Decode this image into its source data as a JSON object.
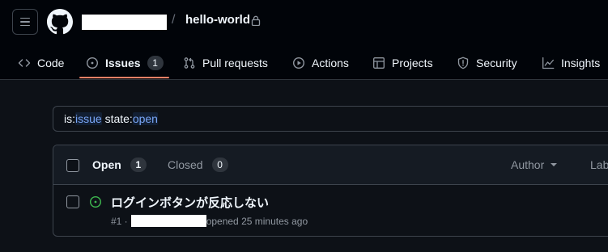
{
  "header": {
    "repo_name": "hello-world",
    "separator": "/"
  },
  "tabs": [
    {
      "label": "Code",
      "icon": "code-icon"
    },
    {
      "label": "Issues",
      "icon": "issue-opened-icon",
      "count": "1",
      "active": true
    },
    {
      "label": "Pull requests",
      "icon": "git-pull-request-icon"
    },
    {
      "label": "Actions",
      "icon": "play-icon"
    },
    {
      "label": "Projects",
      "icon": "table-icon"
    },
    {
      "label": "Security",
      "icon": "shield-icon"
    },
    {
      "label": "Insights",
      "icon": "graph-icon"
    }
  ],
  "search": {
    "tokens": [
      {
        "text": "is:",
        "highlight": false
      },
      {
        "text": "issue",
        "highlight": true
      },
      {
        "text": " state:",
        "highlight": false
      },
      {
        "text": "open",
        "highlight": true
      }
    ]
  },
  "issues": {
    "open_label": "Open",
    "open_count": "1",
    "closed_label": "Closed",
    "closed_count": "0",
    "author_filter": "Author",
    "labels_filter": "Lab",
    "items": [
      {
        "title": "ログインボタンが反応しない",
        "number": "#1 ·",
        "opened_text": "opened 25 minutes ago",
        "state": "open"
      }
    ]
  },
  "colors": {
    "accent_underline": "#f78166",
    "open_state": "#3fb950",
    "search_highlight": "#79a6f7"
  }
}
